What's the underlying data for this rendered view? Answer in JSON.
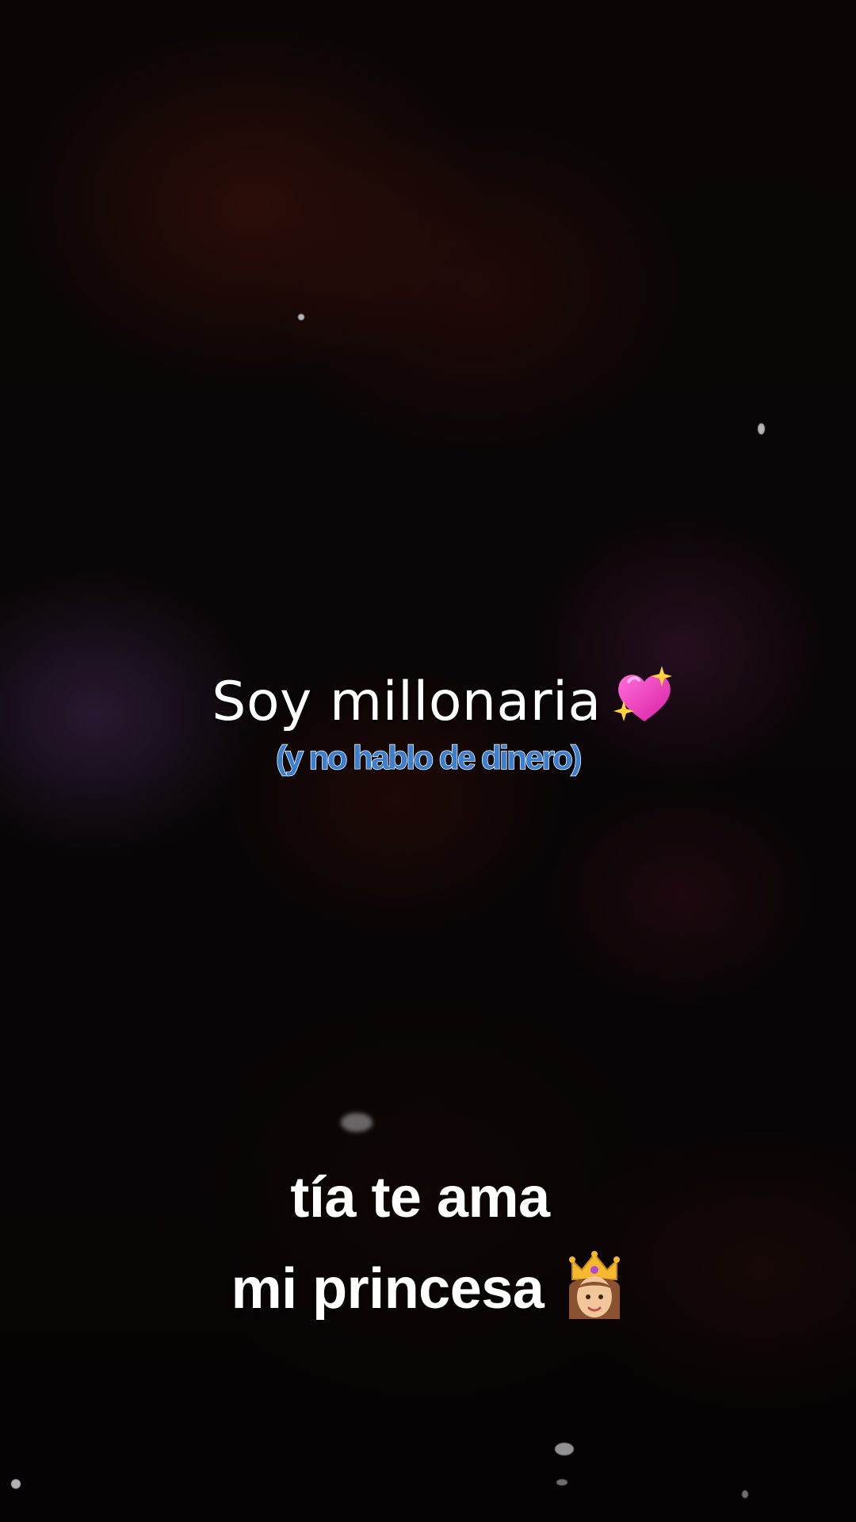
{
  "overlay": {
    "headline": "Soy millonaria",
    "headline_icon": "sparkling-heart-icon",
    "subline": "(y no hablo de dinero)",
    "subline_color": "#3a7fd0"
  },
  "caption": {
    "line1": "tía  te ama",
    "line2": "mi princesa",
    "line2_icon": "princess-icon"
  }
}
